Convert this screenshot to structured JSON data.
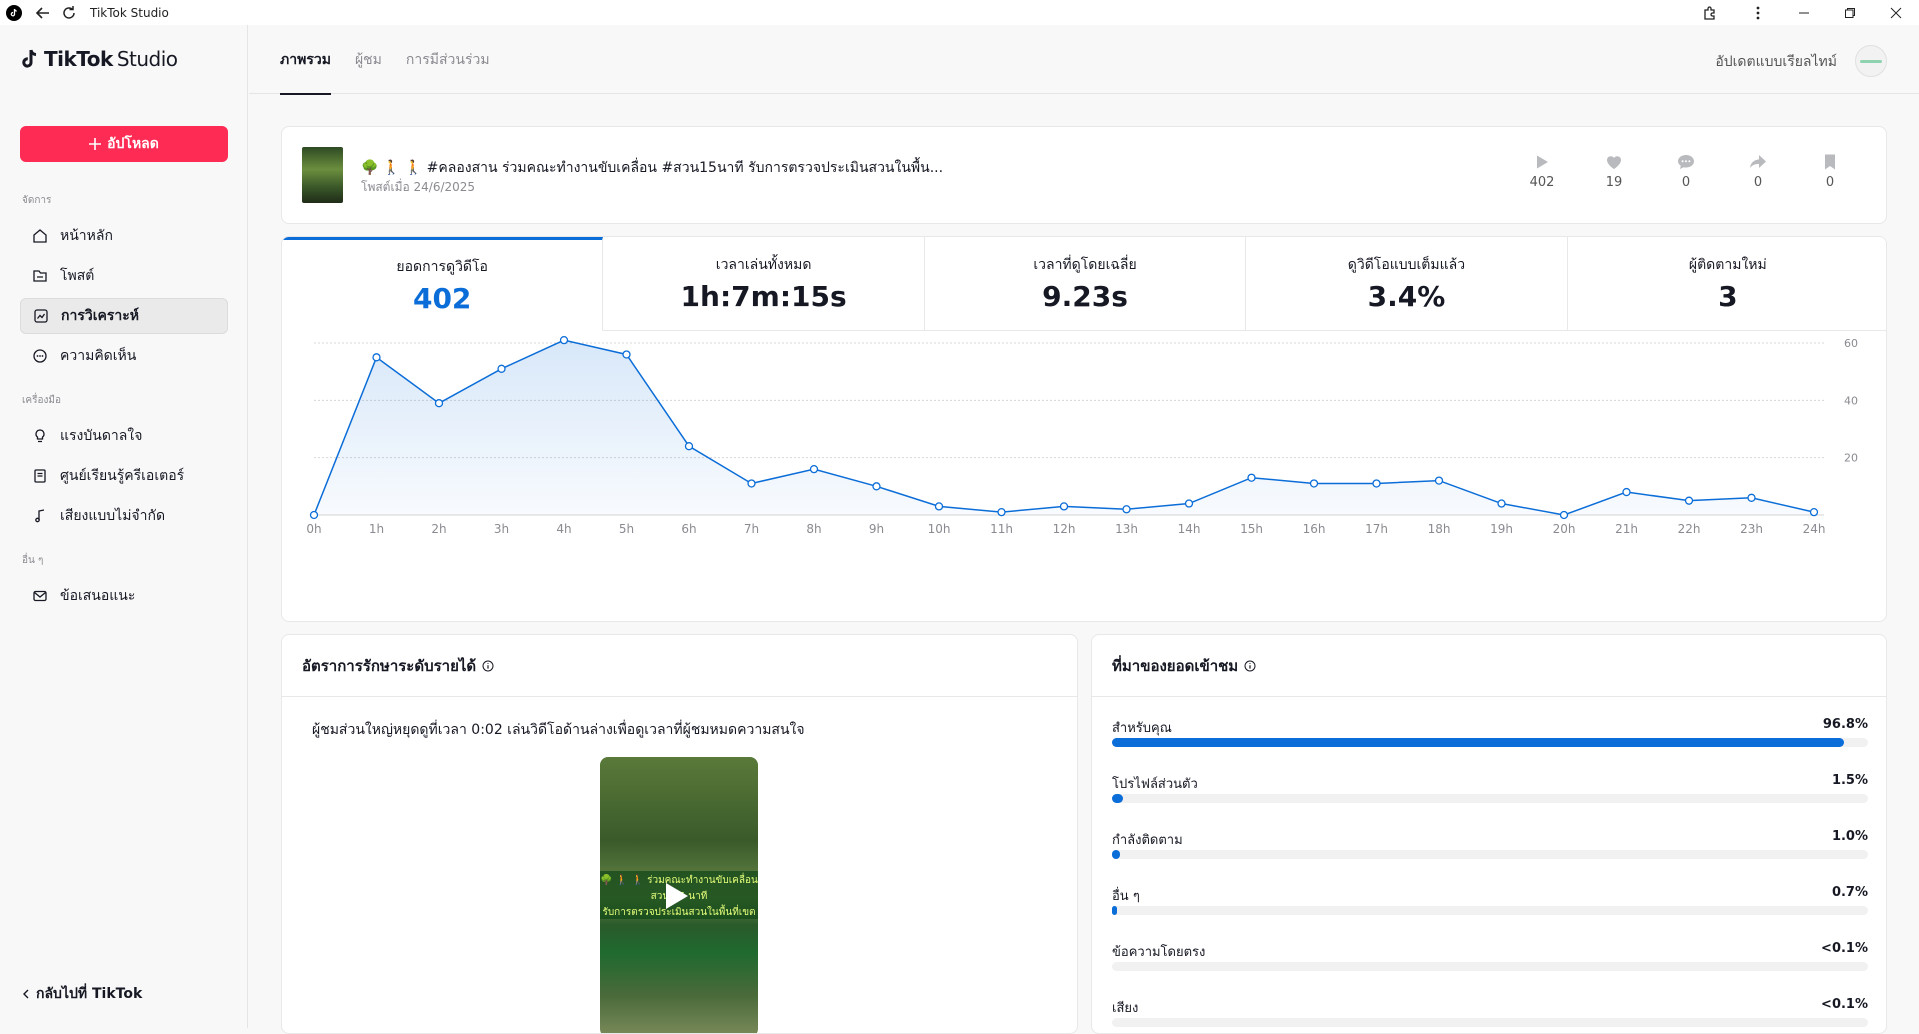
{
  "window": {
    "title": "TikTok Studio"
  },
  "brand": {
    "name_bold": "TikTok",
    "name_light": "Studio"
  },
  "sidebar": {
    "upload_label": "อัปโหลด",
    "sections": [
      "จัดการ",
      "เครื่องมือ",
      "อื่น ๆ"
    ],
    "items": [
      {
        "label": "หน้าหลัก",
        "icon": "home-icon"
      },
      {
        "label": "โพสต์",
        "icon": "folder-icon"
      },
      {
        "label": "การวิเคราะห์",
        "icon": "analytics-icon",
        "active": true
      },
      {
        "label": "ความคิดเห็น",
        "icon": "comment-icon"
      },
      {
        "label": "แรงบันดาลใจ",
        "icon": "lightbulb-icon"
      },
      {
        "label": "ศูนย์เรียนรู้ครีเอเตอร์",
        "icon": "book-icon"
      },
      {
        "label": "เสียงแบบไม่จำกัด",
        "icon": "music-note-icon"
      },
      {
        "label": "ข้อเสนอแนะ",
        "icon": "mail-icon"
      }
    ],
    "back_label": "กลับไปที่ TikTok"
  },
  "header": {
    "tabs": [
      {
        "label": "ภาพรวม",
        "active": true
      },
      {
        "label": "ผู้ชม"
      },
      {
        "label": "การมีส่วนร่วม"
      }
    ],
    "realtime_label": "อัปเดตแบบเรียลไทม์"
  },
  "video": {
    "title": "🌳 🚶 🚶 #คลองสาน ร่วมคณะทำงานขับเคลื่อน #สวน15นาที รับการตรวจประเมินสวนในพื้น...",
    "posted": "โพสต์เมื่อ 24/6/2025",
    "stats": {
      "views": "402",
      "likes": "19",
      "comments": "0",
      "shares": "0",
      "saves": "0"
    }
  },
  "metrics": [
    {
      "label": "ยอดการดูวิดีโอ",
      "value": "402",
      "active": true
    },
    {
      "label": "เวลาเล่นทั้งหมด",
      "value": "1h:7m:15s"
    },
    {
      "label": "เวลาที่ดูโดยเฉลี่ย",
      "value": "9.23s"
    },
    {
      "label": "ดูวิดีโอแบบเต็มแล้ว",
      "value": "3.4%"
    },
    {
      "label": "ผู้ติดตามใหม่",
      "value": "3"
    }
  ],
  "chart_data": {
    "type": "area",
    "x": [
      "0h",
      "1h",
      "2h",
      "3h",
      "4h",
      "5h",
      "6h",
      "7h",
      "8h",
      "9h",
      "10h",
      "11h",
      "12h",
      "13h",
      "14h",
      "15h",
      "16h",
      "17h",
      "18h",
      "19h",
      "20h",
      "21h",
      "22h",
      "23h",
      "24h"
    ],
    "series": [
      {
        "values": [
          0,
          55,
          39,
          51,
          61,
          56,
          24,
          11,
          16,
          10,
          3,
          1,
          3,
          2,
          4,
          13,
          11,
          11,
          12,
          4,
          0,
          8,
          5,
          6,
          1
        ]
      }
    ],
    "ylim": [
      0,
      60
    ],
    "yticks": [
      20,
      40,
      60
    ],
    "color": "#0b6dd8",
    "grid": true
  },
  "retention": {
    "title": "อัตราการรักษาระดับรายได้",
    "description": "ผู้ชมส่วนใหญ่หยุดดูที่เวลา 0:02 เล่นวิดีโอด้านล่างเพื่อดูเวลาที่ผู้ชมหมดความสนใจ",
    "overlay_lines": [
      "🌳 🚶 🚶 ร่วมคณะทำงานขับเคลื่อน",
      "สวน 15 นาที",
      "รับการตรวจประเมินสวนในพื้นที่เขต"
    ]
  },
  "traffic": {
    "title": "ที่มาของยอดเข้าชม",
    "sources": [
      {
        "label": "สำหรับคุณ",
        "pct": "96.8%",
        "fraction": 0.968
      },
      {
        "label": "โปรไฟล์ส่วนตัว",
        "pct": "1.5%",
        "fraction": 0.015
      },
      {
        "label": "กำลังติดตาม",
        "pct": "1.0%",
        "fraction": 0.01
      },
      {
        "label": "อื่น ๆ",
        "pct": "0.7%",
        "fraction": 0.007
      },
      {
        "label": "ข้อความโดยตรง",
        "pct": "<0.1%",
        "fraction": 0.0005
      },
      {
        "label": "เสียง",
        "pct": "<0.1%",
        "fraction": 0.0005
      }
    ]
  }
}
